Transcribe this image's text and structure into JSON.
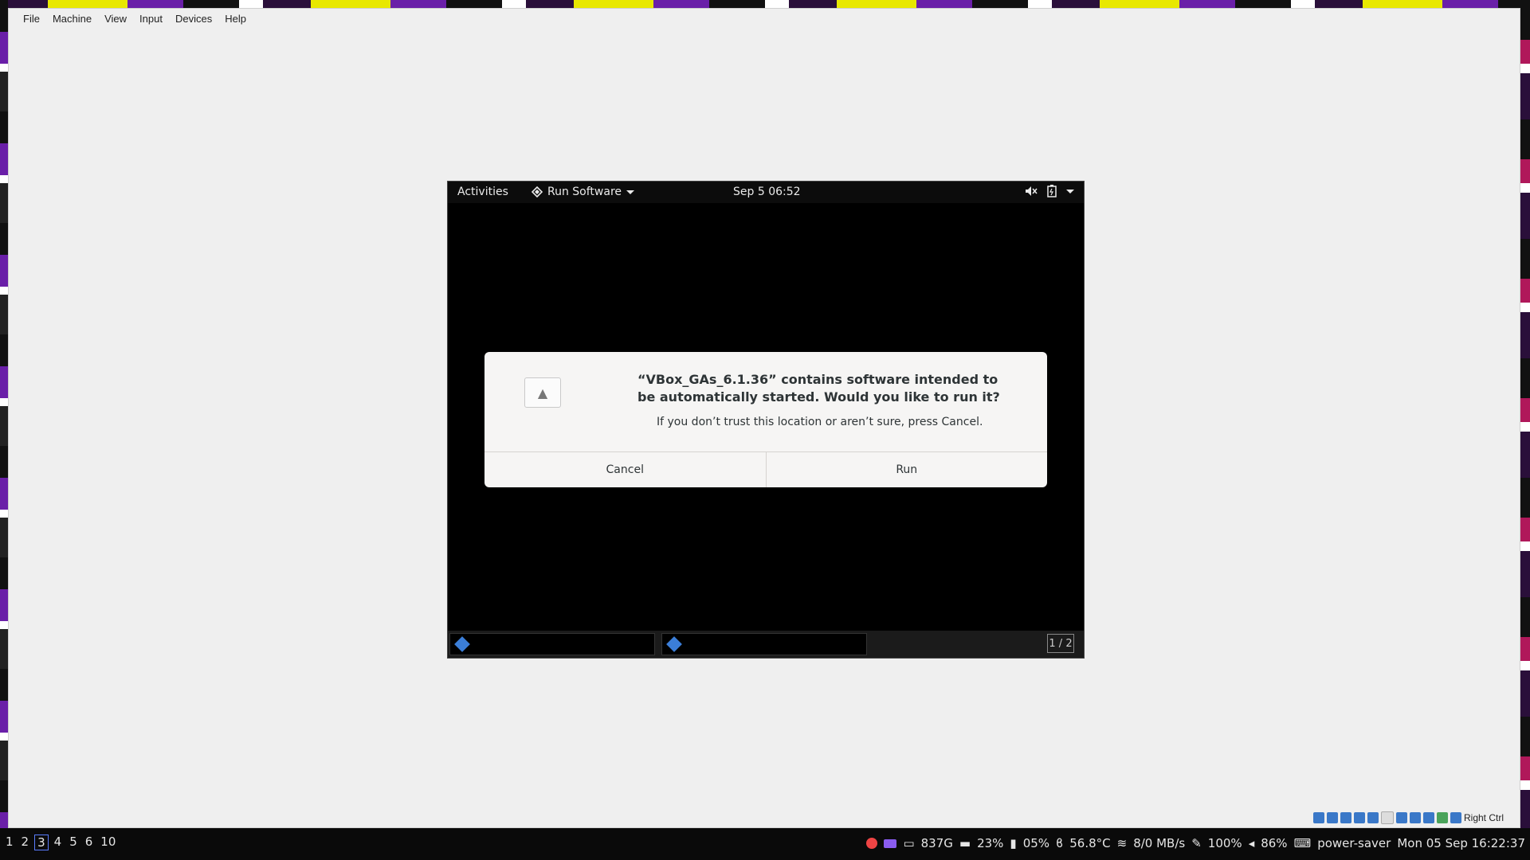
{
  "menubar": {
    "items": [
      "File",
      "Machine",
      "View",
      "Input",
      "Devices",
      "Help"
    ]
  },
  "guest": {
    "top_bar": {
      "activities": "Activities",
      "app_menu": "Run Software",
      "clock": "Sep 5  06:52"
    },
    "dialog": {
      "heading": "“VBox_GAs_6.1.36” contains software intended to be automatically started. Would you like to run it?",
      "subtext": "If you don’t trust this location or aren’t sure, press Cancel.",
      "cancel_label": "Cancel",
      "run_label": "Run"
    },
    "taskbar": {
      "pager": "1 / 2"
    }
  },
  "vbox_status": {
    "host_key": "Right Ctrl"
  },
  "host_bar": {
    "workspaces": [
      "1",
      "2",
      "3",
      "4",
      "5",
      "6",
      "10"
    ],
    "active_workspace": "3",
    "disk": "837G",
    "memory": "23%",
    "battery_percent": "05%",
    "temp": "56.8°C",
    "network": "8/0 MB/s",
    "brightness": "100%",
    "volume": "86%",
    "power_profile": "power-saver",
    "datetime": "Mon 05 Sep 16:22:37"
  }
}
